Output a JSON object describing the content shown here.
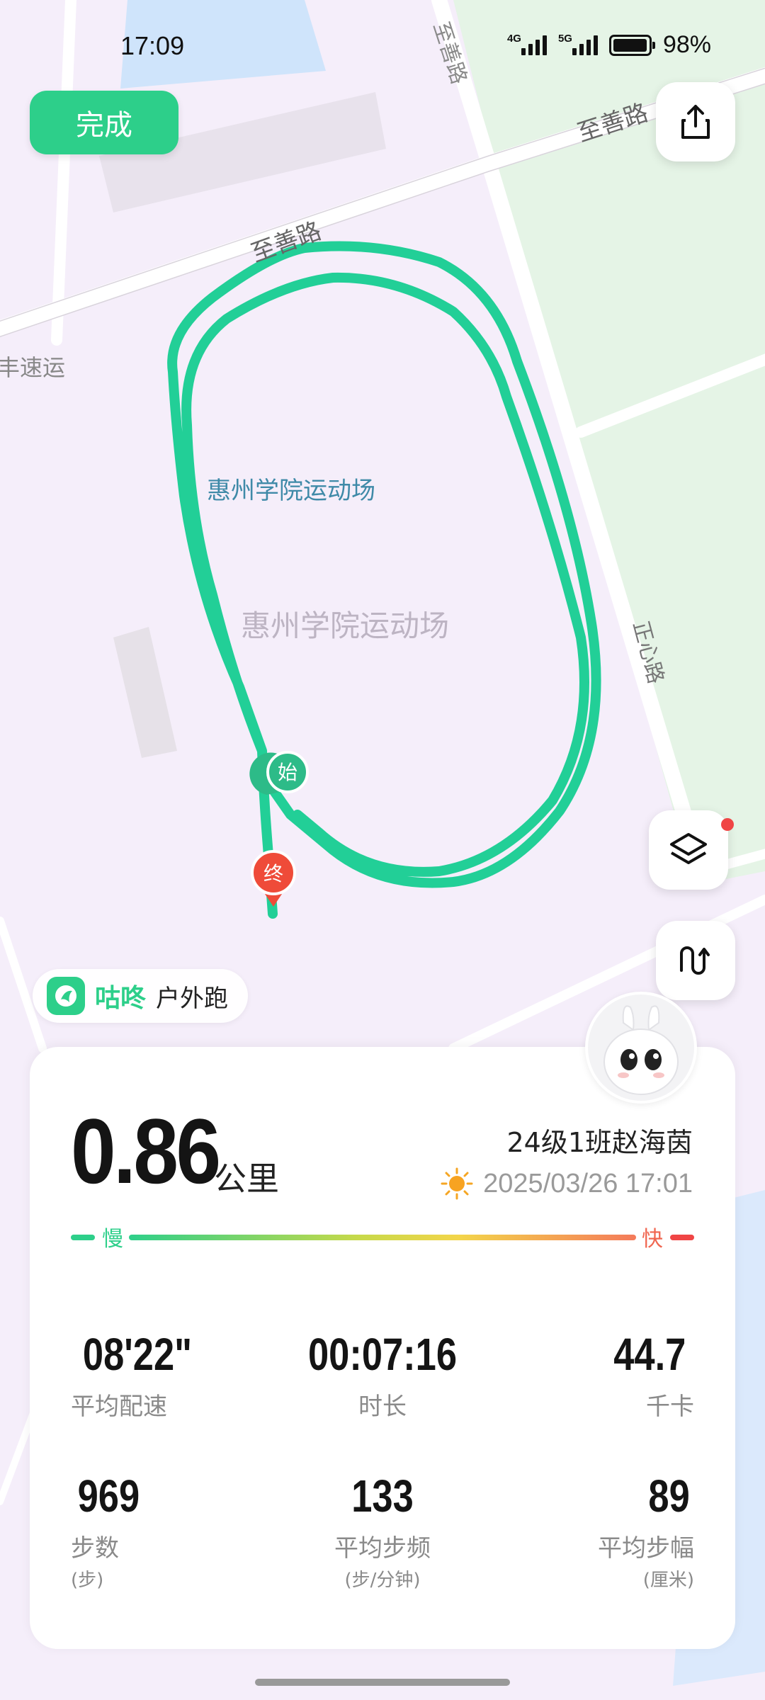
{
  "status_bar": {
    "time": "17:09",
    "network_1": "4G",
    "network_2": "5G",
    "battery": "98%"
  },
  "toolbar": {
    "done_label": "完成"
  },
  "map": {
    "road_labels": [
      "至善路",
      "至善路",
      "正心路",
      "正心路",
      "丰速运"
    ],
    "poi_label_primary": "惠州学院运动场",
    "poi_label_secondary": "惠州学院运动场",
    "start_marker": "始",
    "end_marker": "终",
    "route_color": "#22cf97"
  },
  "brand": {
    "name": "咕咚",
    "mode": "户外跑"
  },
  "summary": {
    "distance": "0.86",
    "distance_unit": "公里",
    "user": "24级1班赵海茵",
    "date": "2025/03/26 17:01",
    "pace_slow_label": "慢",
    "pace_fast_label": "快"
  },
  "stats": [
    {
      "value": "08'22\"",
      "label": "平均配速",
      "sub": ""
    },
    {
      "value": "00:07:16",
      "label": "时长",
      "sub": ""
    },
    {
      "value": "44.7",
      "label": "千卡",
      "sub": ""
    },
    {
      "value": "969",
      "label": "步数",
      "sub": "(步)"
    },
    {
      "value": "133",
      "label": "平均步频",
      "sub": "(步/分钟)"
    },
    {
      "value": "89",
      "label": "平均步幅",
      "sub": "(厘米)"
    }
  ],
  "colors": {
    "accent": "#2dcf8a",
    "slow": "#2dcf8a",
    "fast": "#f04545"
  }
}
